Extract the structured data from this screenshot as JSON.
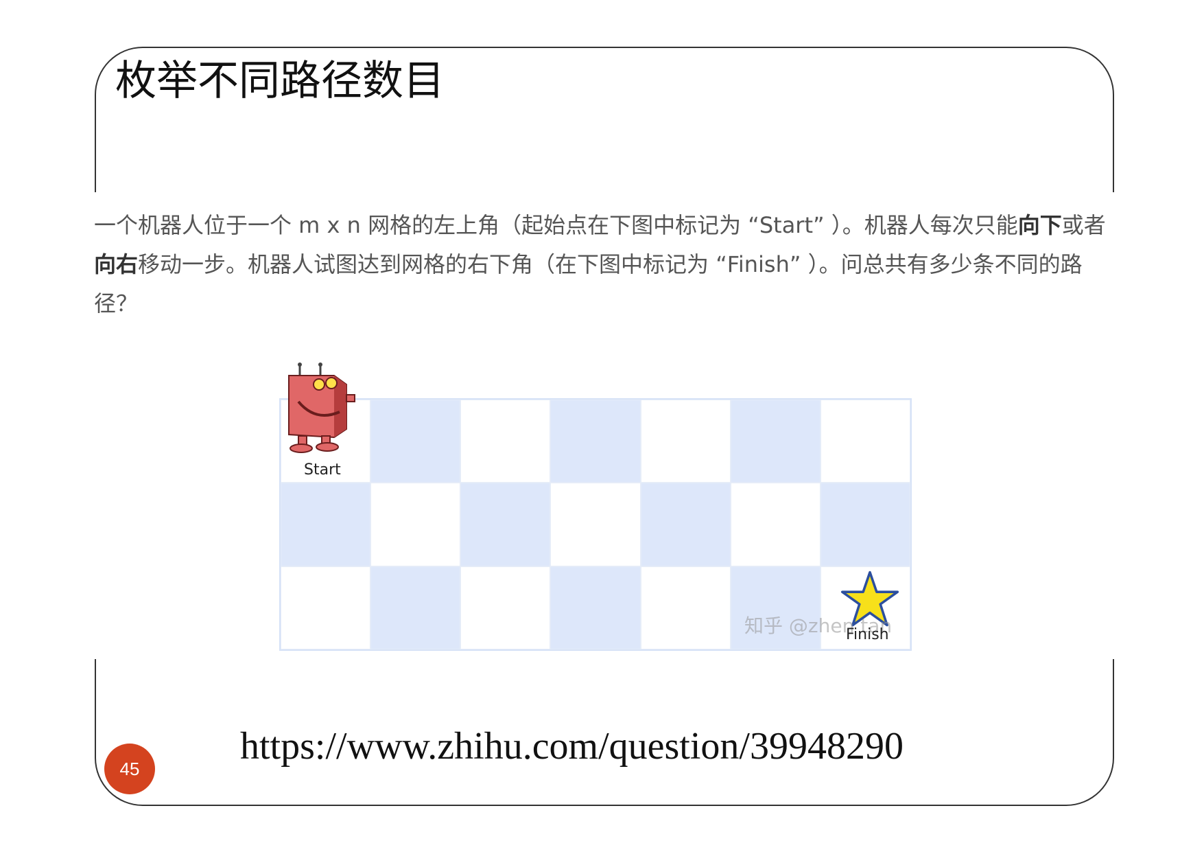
{
  "slide": {
    "title": "枚举不同路径数目",
    "url": "https://www.zhihu.com/question/39948290",
    "page_number": "45"
  },
  "problem": {
    "text_1": "一个机器人位于一个 m x n 网格的左上角（起始点在下图中标记为 “Start” ）。机器人每次只能",
    "bold_1": "向下",
    "text_2": "或者",
    "bold_2": "向右",
    "text_3": "移动一步。机器人试图达到网格的右下角（在下图中标记为 “Finish” ）。问总共有多少条不同的路径？"
  },
  "figure": {
    "start_label": "Start",
    "finish_label": "Finish",
    "watermark": "知乎 @zhen tan",
    "rows": 3,
    "cols": 7
  },
  "colors": {
    "badge": "#d4431f",
    "cell_blue": "#dde7fa",
    "robot_red": "#d9534f",
    "star_yellow": "#f7e01a"
  },
  "icons": [
    "robot-icon",
    "star-icon"
  ]
}
